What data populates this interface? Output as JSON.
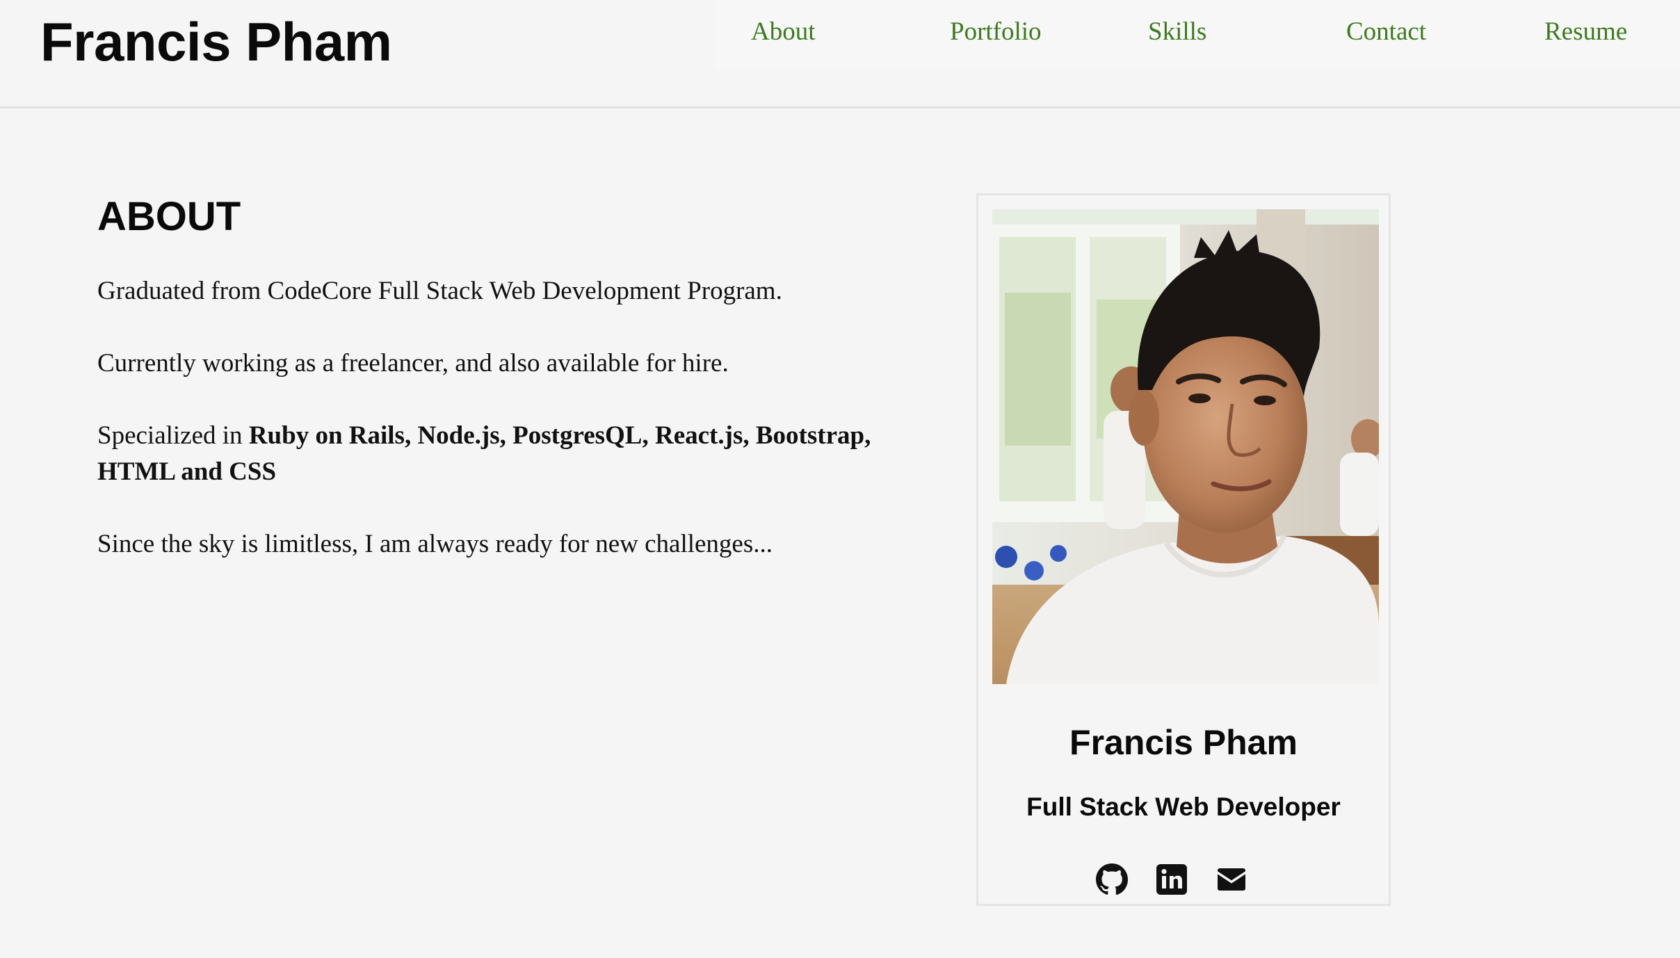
{
  "header": {
    "brand": "Francis Pham",
    "nav": [
      {
        "label": "About"
      },
      {
        "label": "Portfolio"
      },
      {
        "label": "Skills"
      },
      {
        "label": "Contact"
      },
      {
        "label": "Resume"
      }
    ]
  },
  "about": {
    "title": "ABOUT",
    "p1": "Graduated from CodeCore Full Stack Web Development Program.",
    "p2": "Currently working as a freelancer, and also available for hire.",
    "p3_prefix": "Specialized in",
    "p3_skills": "Ruby on Rails, Node.js, PostgresQL, React.js, Bootstrap, HTML and CSS",
    "p4": "Since the sky is limitless, I am always ready for new challenges..."
  },
  "card": {
    "name": "Francis Pham",
    "role": "Full Stack Web Developer",
    "socials": [
      {
        "icon": "github-icon"
      },
      {
        "icon": "linkedin-icon"
      },
      {
        "icon": "envelope-icon"
      }
    ]
  },
  "colors": {
    "background": "#f5f5f5",
    "nav_link": "#3d7a1f",
    "text": "#111111",
    "divider": "#e2e2e2"
  }
}
